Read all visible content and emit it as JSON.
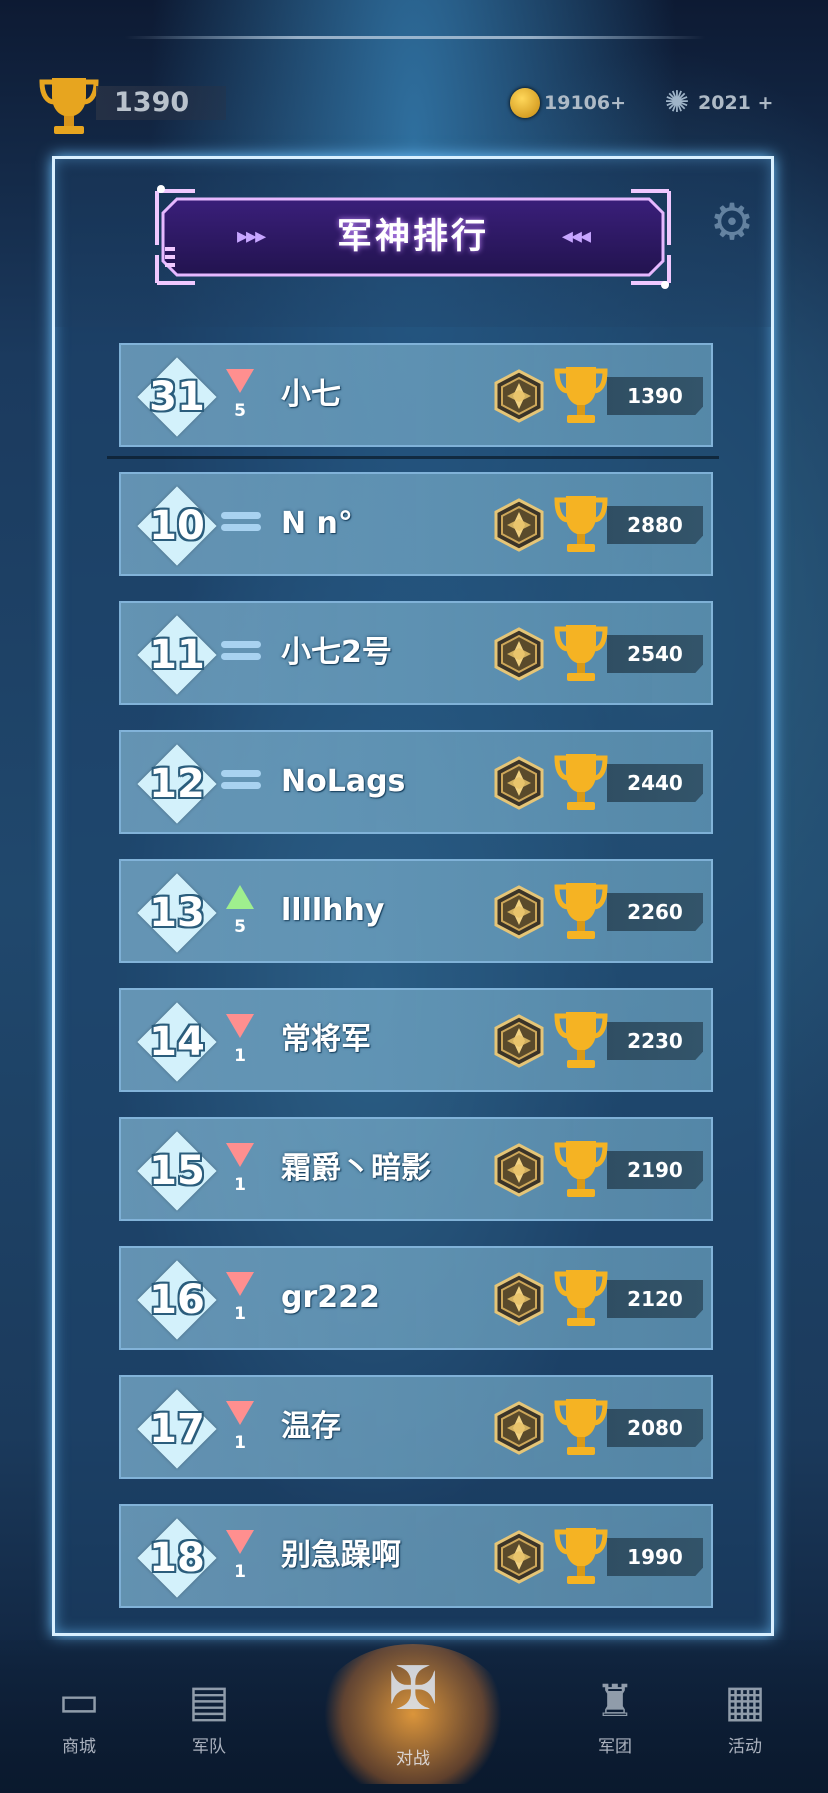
{
  "hud": {
    "trophy_count": "1390",
    "coin_value": "19106+",
    "gem_value": "2021 +"
  },
  "panel": {
    "title": "军神排行",
    "title_arrows_left": "▸▸▸",
    "title_arrows_right": "◂◂◂"
  },
  "rows": [
    {
      "rank": "31",
      "change": "down",
      "change_value": "5",
      "name": "小七",
      "score": "1390"
    },
    {
      "rank": "10",
      "change": "same",
      "change_value": "",
      "name": "N n°",
      "score": "2880"
    },
    {
      "rank": "11",
      "change": "same",
      "change_value": "",
      "name": "小七2号",
      "score": "2540"
    },
    {
      "rank": "12",
      "change": "same",
      "change_value": "",
      "name": "NoLags",
      "score": "2440"
    },
    {
      "rank": "13",
      "change": "up",
      "change_value": "5",
      "name": "llllhhy",
      "score": "2260"
    },
    {
      "rank": "14",
      "change": "down",
      "change_value": "1",
      "name": "常将军",
      "score": "2230"
    },
    {
      "rank": "15",
      "change": "down",
      "change_value": "1",
      "name": "霜爵丶暗影",
      "score": "2190"
    },
    {
      "rank": "16",
      "change": "down",
      "change_value": "1",
      "name": "gr222",
      "score": "2120"
    },
    {
      "rank": "17",
      "change": "down",
      "change_value": "1",
      "name": "温存",
      "score": "2080"
    },
    {
      "rank": "18",
      "change": "down",
      "change_value": "1",
      "name": "别急躁啊",
      "score": "1990"
    }
  ],
  "colors": {
    "down": "#ff8f8f",
    "up": "#9fef8e",
    "same": "#a8d2f0",
    "trophy": "#f5b323",
    "panel_border": "#d9f0ff"
  },
  "bottom_nav": {
    "items": [
      {
        "name": "shop",
        "icon": "shop-icon",
        "label": "商城"
      },
      {
        "name": "cards",
        "icon": "cards-icon",
        "label": "军队"
      },
      {
        "name": "battle",
        "icon": "battle-icon",
        "label": "对战"
      },
      {
        "name": "legion",
        "icon": "legion-icon",
        "label": "军团"
      },
      {
        "name": "events",
        "icon": "events-icon",
        "label": "活动"
      }
    ]
  }
}
